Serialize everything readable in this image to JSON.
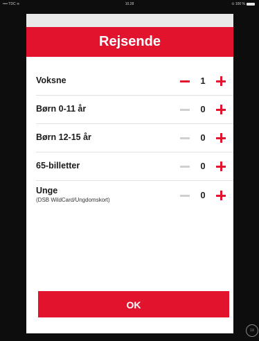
{
  "status_bar": {
    "left": "•••• TDC ≋",
    "time": "10.28",
    "right": "⊙ 100 %"
  },
  "dialog": {
    "title": "Rejsende",
    "rows": [
      {
        "label": "Voksne",
        "sublabel": "",
        "count": "1",
        "minus_enabled": true
      },
      {
        "label": "Børn 0-11 år",
        "sublabel": "",
        "count": "0",
        "minus_enabled": false
      },
      {
        "label": "Børn 12-15 år",
        "sublabel": "",
        "count": "0",
        "minus_enabled": false
      },
      {
        "label": "65-billetter",
        "sublabel": "",
        "count": "0",
        "minus_enabled": false
      },
      {
        "label": "Unge",
        "sublabel": "(DSB WildCard/Ungdomskort)",
        "count": "0",
        "minus_enabled": false
      }
    ],
    "ok_label": "OK"
  },
  "home_button": "1X",
  "icons": {
    "minus": "minus-icon",
    "plus": "plus-icon"
  },
  "colors": {
    "accent": "#e2142d",
    "disabled": "#d0d0d0"
  }
}
